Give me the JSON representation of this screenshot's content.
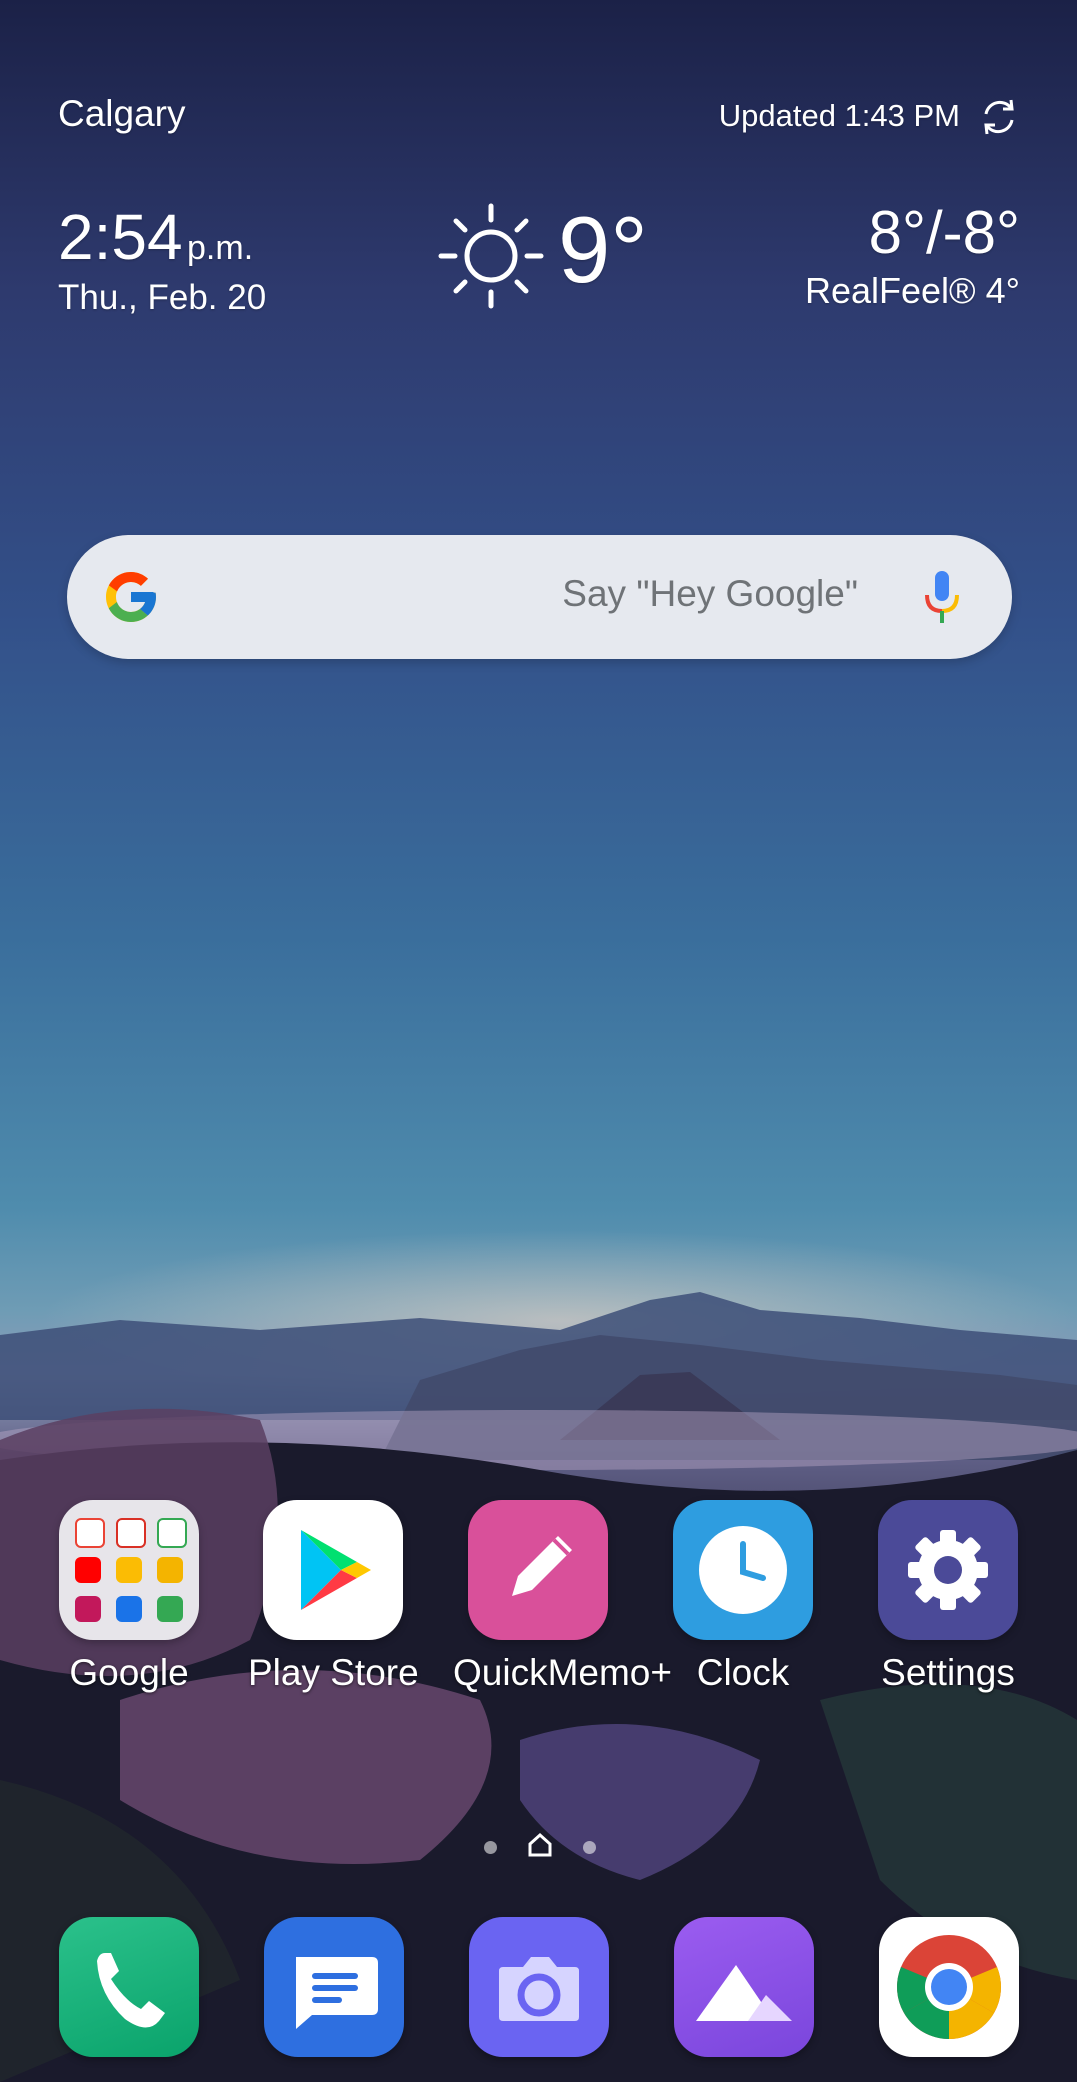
{
  "weather": {
    "city": "Calgary",
    "updated": "Updated 1:43 PM",
    "time": "2:54",
    "ampm": "p.m.",
    "date": "Thu., Feb. 20",
    "temp": "9°",
    "hilo": "8°/-8°",
    "realfeel": "RealFeel® 4°",
    "condition_icon": "sun-icon",
    "refresh_icon": "refresh-icon"
  },
  "search": {
    "placeholder": "Say \"Hey Google\"",
    "logo_icon": "google-g-icon",
    "mic_icon": "mic-icon"
  },
  "apps": [
    {
      "label": "Google",
      "icon": "google-folder-icon"
    },
    {
      "label": "Play Store",
      "icon": "play-store-icon"
    },
    {
      "label": "QuickMemo+",
      "icon": "quickmemo-icon"
    },
    {
      "label": "Clock",
      "icon": "clock-icon"
    },
    {
      "label": "Settings",
      "icon": "settings-gear-icon"
    }
  ],
  "page_indicator": {
    "pages": 3,
    "current": "home"
  },
  "dock": [
    {
      "name": "Phone",
      "icon": "phone-icon",
      "color": "#1fb37a"
    },
    {
      "name": "Messages",
      "icon": "messages-icon",
      "color": "#2e6fe0"
    },
    {
      "name": "Camera",
      "icon": "camera-icon",
      "color": "#6a64f2"
    },
    {
      "name": "Gallery",
      "icon": "gallery-icon",
      "color": "#8a52e6"
    },
    {
      "name": "Chrome",
      "icon": "chrome-icon",
      "color": "#ffffff"
    }
  ]
}
